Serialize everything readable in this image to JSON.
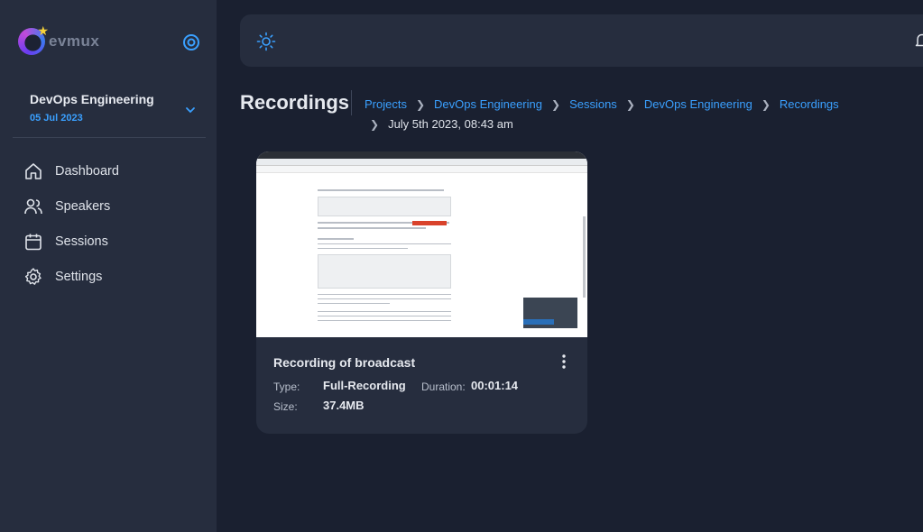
{
  "app": {
    "name": "evmux"
  },
  "sidebar": {
    "org_name": "DevOps Engineering",
    "org_date": "05 Jul 2023",
    "items": [
      {
        "label": "Dashboard",
        "icon": "home-icon"
      },
      {
        "label": "Speakers",
        "icon": "users-icon"
      },
      {
        "label": "Sessions",
        "icon": "calendar-icon"
      },
      {
        "label": "Settings",
        "icon": "gear-icon"
      }
    ]
  },
  "header": {
    "title": "Recordings",
    "breadcrumbs": [
      "Projects",
      "DevOps Engineering",
      "Sessions",
      "DevOps Engineering",
      "Recordings"
    ],
    "current": "July 5th 2023, 08:43 am"
  },
  "recording": {
    "title": "Recording of broadcast",
    "type_label": "Type:",
    "type_value": "Full-Recording",
    "duration_label": "Duration:",
    "duration_value": "00:01:14",
    "size_label": "Size:",
    "size_value": "37.4MB"
  },
  "colors": {
    "accent": "#3aa0ff",
    "sidebar_bg": "#262d3e",
    "page_bg": "#1a2030"
  }
}
